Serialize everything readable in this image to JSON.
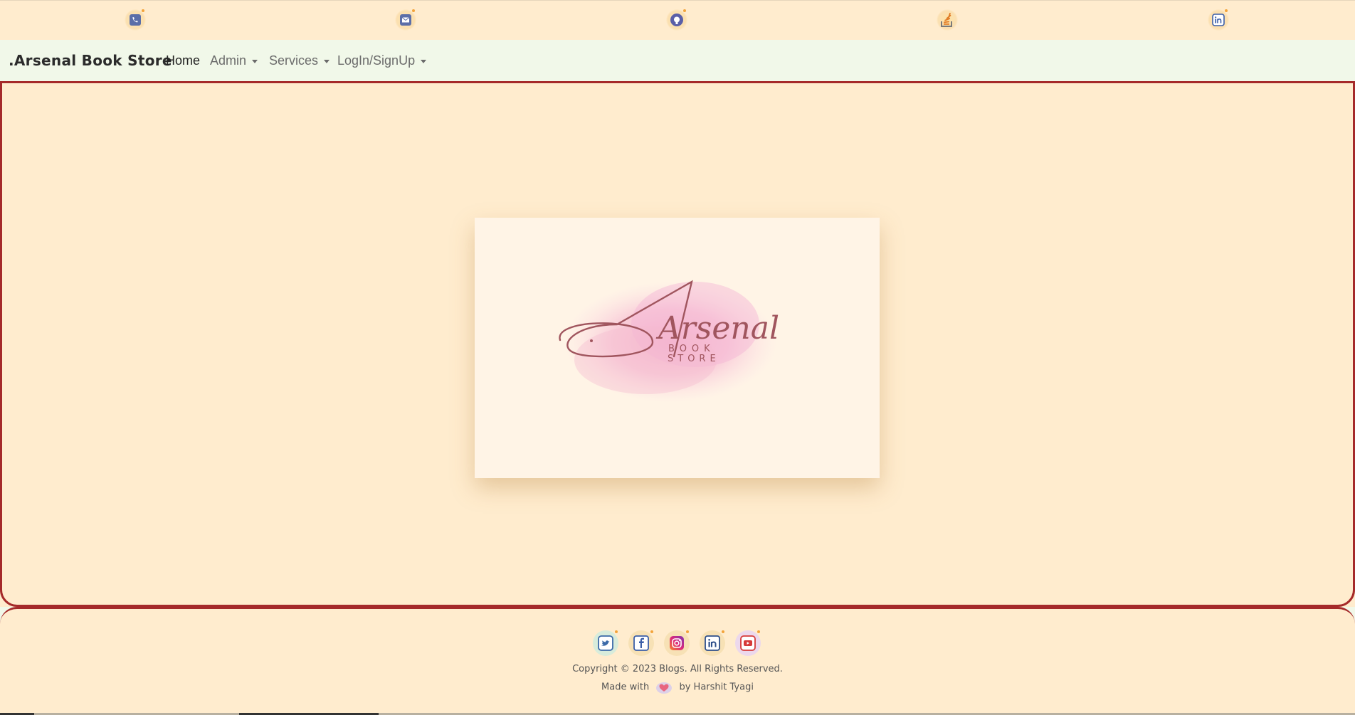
{
  "topbar": {
    "icons": [
      {
        "name": "phone-icon",
        "color": "#5b6ea8"
      },
      {
        "name": "mail-icon",
        "color": "#5b6ea8"
      },
      {
        "name": "github-icon",
        "color": "#5a5fa8"
      },
      {
        "name": "stackoverflow-icon",
        "color": "#e07b24"
      },
      {
        "name": "linkedin-icon",
        "color": "#3b5fa8"
      }
    ]
  },
  "navbar": {
    "brand": ".Arsenal Book Store",
    "items": [
      {
        "label": "Home",
        "active": true,
        "dropdown": false
      },
      {
        "label": "Admin",
        "active": false,
        "dropdown": true
      },
      {
        "label": "Services",
        "active": false,
        "dropdown": true
      },
      {
        "label": "LogIn/SignUp",
        "active": false,
        "dropdown": true
      }
    ]
  },
  "hero": {
    "logo_script": "Arsenal",
    "logo_line1": "BOOK",
    "logo_line2": "STORE"
  },
  "footer": {
    "socials": [
      {
        "name": "twitter-icon",
        "color": "#3b6aa8"
      },
      {
        "name": "facebook-icon",
        "color": "#3b5fa8"
      },
      {
        "name": "instagram-icon",
        "color": "#c13584"
      },
      {
        "name": "linkedin-icon",
        "color": "#2e4f8a"
      },
      {
        "name": "youtube-icon",
        "color": "#d63a3a"
      }
    ],
    "copyright": "Copyright © 2023 Blogs. All Rights Reserved.",
    "made_with": "Made with",
    "by": "by Harshit Tyagi"
  },
  "colors": {
    "background": "#ffecce",
    "navbar": "#f1f8e9",
    "border": "#a52a2a"
  }
}
